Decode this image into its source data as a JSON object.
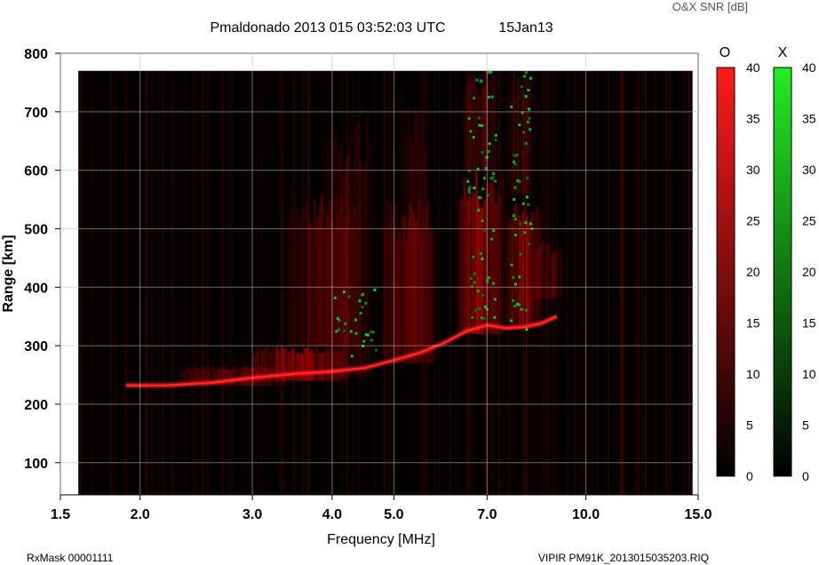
{
  "header": {
    "title": "Pmaldonado 2013 015 03:52:03 UTC",
    "date": "15Jan13",
    "snr_label": "O&X SNR [dB]"
  },
  "footer": {
    "rx_mask": "RxMask 00001111",
    "file": "VIPIR  PM91K_2013015035203.RIQ"
  },
  "colorbars": {
    "o": {
      "label": "O",
      "color": "#ff1a1a",
      "ticks": [
        "40",
        "35",
        "30",
        "25",
        "20",
        "15",
        "10",
        "5",
        "0"
      ],
      "range": [
        0,
        40
      ]
    },
    "x": {
      "label": "X",
      "color": "#22ee22",
      "ticks": [
        "40",
        "35",
        "30",
        "25",
        "20",
        "15",
        "10",
        "5",
        "0"
      ],
      "range": [
        0,
        40
      ]
    }
  },
  "chart_data": {
    "type": "heatmap",
    "xlabel": "Frequency [MHz]",
    "ylabel": "Range [km]",
    "x_scale": "log",
    "xlim": [
      1.5,
      15.0
    ],
    "ylim": [
      45,
      800
    ],
    "x_ticks": [
      {
        "v": 1.5,
        "label": "1.5"
      },
      {
        "v": 2.0,
        "label": "2.0"
      },
      {
        "v": 3.0,
        "label": "3.0"
      },
      {
        "v": 4.0,
        "label": "4.0"
      },
      {
        "v": 5.0,
        "label": "5.0"
      },
      {
        "v": 7.0,
        "label": "7.0"
      },
      {
        "v": 10.0,
        "label": "10.0"
      },
      {
        "v": 15.0,
        "label": "15.0"
      }
    ],
    "y_ticks": [
      {
        "v": 100,
        "label": "100"
      },
      {
        "v": 200,
        "label": "200"
      },
      {
        "v": 300,
        "label": "300"
      },
      {
        "v": 400,
        "label": "400"
      },
      {
        "v": 500,
        "label": "500"
      },
      {
        "v": 600,
        "label": "600"
      },
      {
        "v": 700,
        "label": "700"
      },
      {
        "v": 800,
        "label": "800"
      }
    ],
    "data_extent": {
      "x": [
        1.6,
        14.7
      ],
      "y": [
        45,
        770
      ]
    },
    "grid": true,
    "o_trace": [
      {
        "f": 1.9,
        "h": 232
      },
      {
        "f": 2.2,
        "h": 232
      },
      {
        "f": 2.6,
        "h": 237
      },
      {
        "f": 3.0,
        "h": 245
      },
      {
        "f": 3.5,
        "h": 252
      },
      {
        "f": 4.0,
        "h": 256
      },
      {
        "f": 4.5,
        "h": 262
      },
      {
        "f": 5.0,
        "h": 275
      },
      {
        "f": 5.5,
        "h": 288
      },
      {
        "f": 6.0,
        "h": 305
      },
      {
        "f": 6.5,
        "h": 325
      },
      {
        "f": 7.0,
        "h": 335
      },
      {
        "f": 7.5,
        "h": 330
      },
      {
        "f": 8.0,
        "h": 332
      },
      {
        "f": 8.5,
        "h": 338
      },
      {
        "f": 9.0,
        "h": 350
      }
    ],
    "o_regions": [
      {
        "f": [
          2.3,
          3.4
        ],
        "h": [
          232,
          265
        ],
        "snr": 20
      },
      {
        "f": [
          3.0,
          4.2
        ],
        "h": [
          240,
          300
        ],
        "snr": 27
      },
      {
        "f": [
          3.4,
          4.4
        ],
        "h": [
          300,
          560
        ],
        "snr": 16
      },
      {
        "f": [
          3.9,
          4.6
        ],
        "h": [
          245,
          700
        ],
        "snr": 12
      },
      {
        "f": [
          4.8,
          5.8
        ],
        "h": [
          270,
          550
        ],
        "snr": 20
      },
      {
        "f": [
          5.1,
          5.6
        ],
        "h": [
          300,
          740
        ],
        "snr": 12
      },
      {
        "f": [
          6.3,
          7.4
        ],
        "h": [
          320,
          600
        ],
        "snr": 28
      },
      {
        "f": [
          6.4,
          7.2
        ],
        "h": [
          600,
          770
        ],
        "snr": 16
      },
      {
        "f": [
          7.5,
          8.5
        ],
        "h": [
          330,
          560
        ],
        "snr": 26
      },
      {
        "f": [
          8.2,
          9.2
        ],
        "h": [
          380,
          480
        ],
        "snr": 16
      },
      {
        "f": [
          7.6,
          8.2
        ],
        "h": [
          560,
          770
        ],
        "snr": 14
      }
    ],
    "x_regions": [
      {
        "f": [
          4.0,
          4.7
        ],
        "h": [
          280,
          400
        ],
        "snr": 18
      },
      {
        "f": [
          6.5,
          7.2
        ],
        "h": [
          340,
          770
        ],
        "snr": 25
      },
      {
        "f": [
          7.6,
          8.2
        ],
        "h": [
          330,
          770
        ],
        "snr": 24
      }
    ]
  }
}
